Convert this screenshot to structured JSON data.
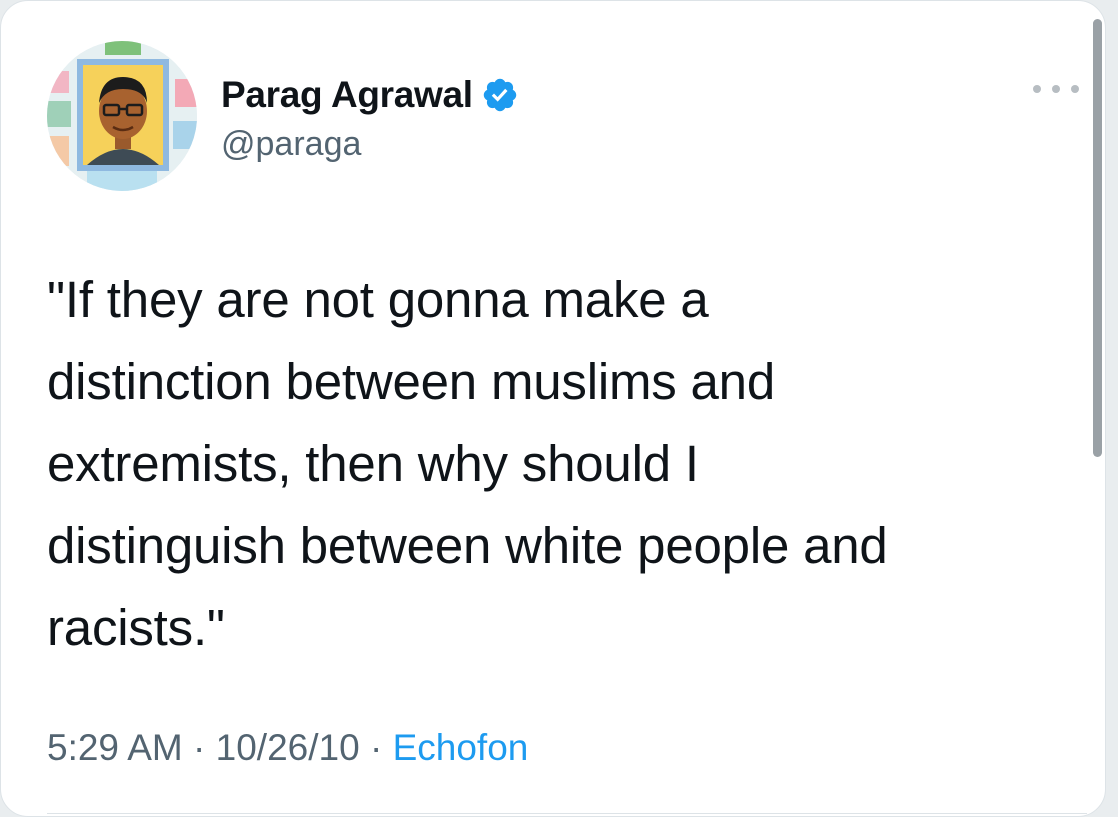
{
  "user": {
    "display_name": "Parag Agrawal",
    "handle": "@paraga",
    "verified": true,
    "avatar_icon": "cartoon-avatar-portrait"
  },
  "tweet": {
    "text": "\"If they are not gonna make a\ndistinction between muslims and\nextremists, then why should I\ndistinguish between white people and\nracists.\"",
    "time": "5:29 AM",
    "separator": "·",
    "date": "10/26/10",
    "source": "Echofon"
  },
  "menu": {
    "icon": "more-horizontal-icon"
  },
  "colors": {
    "accent": "#1d9bf0",
    "secondary_text": "#536471",
    "primary_text": "#0f1419"
  }
}
